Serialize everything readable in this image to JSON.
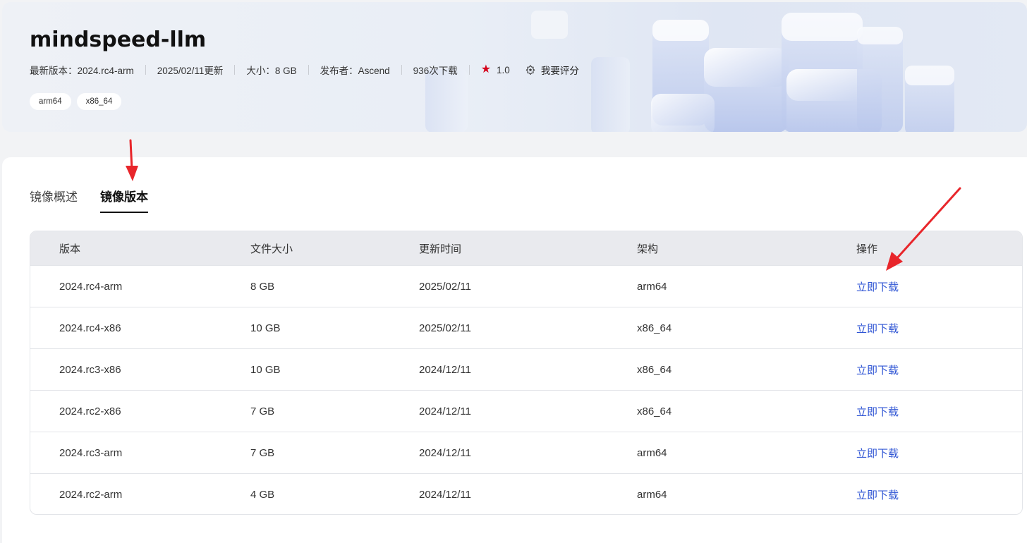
{
  "header": {
    "title": "mindspeed-llm",
    "meta": {
      "latest_version": "最新版本：2024.rc4-arm",
      "updated": "2025/02/11更新",
      "size": "大小：8 GB",
      "publisher": "发布者：Ascend",
      "downloads": "936次下载",
      "rating": "1.0",
      "rate_label": "我要评分"
    },
    "tags": [
      "arm64",
      "x86_64"
    ]
  },
  "tabs": [
    {
      "label": "镜像概述",
      "active": false
    },
    {
      "label": "镜像版本",
      "active": true
    }
  ],
  "table": {
    "headers": {
      "version": "版本",
      "size": "文件大小",
      "time": "更新时间",
      "arch": "架构",
      "op": "操作"
    },
    "rows": [
      {
        "version": "2024.rc4-arm",
        "size": "8 GB",
        "time": "2025/02/11",
        "arch": "arm64",
        "op": "立即下载"
      },
      {
        "version": "2024.rc4-x86",
        "size": "10 GB",
        "time": "2025/02/11",
        "arch": "x86_64",
        "op": "立即下载"
      },
      {
        "version": "2024.rc3-x86",
        "size": "10 GB",
        "time": "2024/12/11",
        "arch": "x86_64",
        "op": "立即下载"
      },
      {
        "version": "2024.rc2-x86",
        "size": "7 GB",
        "time": "2024/12/11",
        "arch": "x86_64",
        "op": "立即下载"
      },
      {
        "version": "2024.rc3-arm",
        "size": "7 GB",
        "time": "2024/12/11",
        "arch": "arm64",
        "op": "立即下载"
      },
      {
        "version": "2024.rc2-arm",
        "size": "4 GB",
        "time": "2024/12/11",
        "arch": "arm64",
        "op": "立即下载"
      }
    ]
  },
  "colors": {
    "accent": "#2f55d4",
    "star": "#d4001a",
    "annotation_arrow": "#e8262b"
  },
  "icons": {
    "rating": "star-icon",
    "rate_action": "rate-badge-icon"
  }
}
